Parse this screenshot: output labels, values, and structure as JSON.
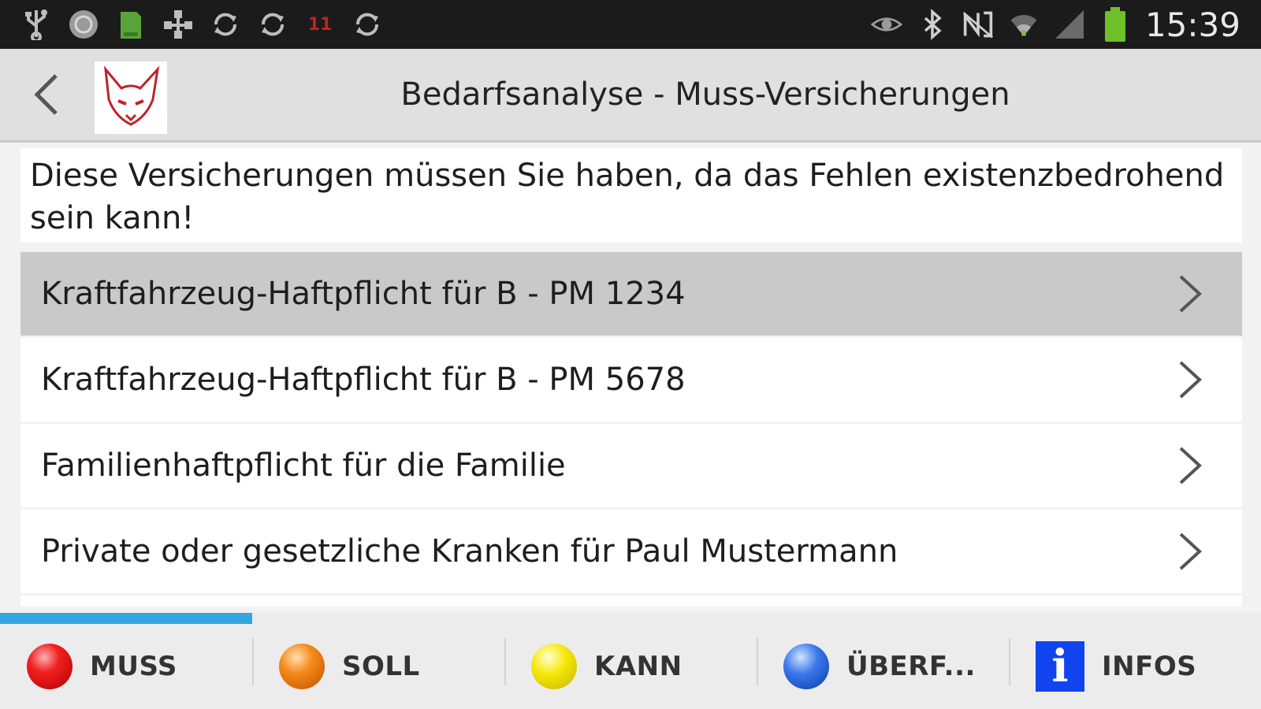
{
  "status_bar": {
    "time": "15:39",
    "left_icons": [
      "usb-icon",
      "sync-circle-icon",
      "sd-card-icon",
      "network-icon",
      "sync-icon",
      "sync-icon",
      "calendar-icon",
      "sync-icon"
    ],
    "right_icons": [
      "eye-icon",
      "bluetooth-icon",
      "nfc-icon",
      "wifi-icon",
      "signal-icon",
      "battery-icon"
    ],
    "calendar_day": "11"
  },
  "action_bar": {
    "title": "Bedarfsanalyse - Muss-Versicherungen",
    "back_icon": "chevron-left-icon",
    "logo_icon": "fox-logo-icon"
  },
  "intro_text": "Diese Versicherungen müssen Sie haben, da das Fehlen existenzbedrohend sein kann!",
  "list": [
    {
      "label": "Kraftfahrzeug-Haftpflicht für B - PM 1234",
      "selected": true
    },
    {
      "label": "Kraftfahrzeug-Haftpflicht für B - PM 5678",
      "selected": false
    },
    {
      "label": "Familienhaftpflicht für die Familie",
      "selected": false
    },
    {
      "label": "Private oder gesetzliche Kranken für Paul Mustermann",
      "selected": false
    }
  ],
  "tabs": [
    {
      "label": "MUSS",
      "icon": "red-ball-icon",
      "color": "#e01010",
      "active": true
    },
    {
      "label": "SOLL",
      "icon": "orange-ball-icon",
      "color": "#f07a10",
      "active": false
    },
    {
      "label": "KANN",
      "icon": "yellow-ball-icon",
      "color": "#f2e000",
      "active": false
    },
    {
      "label": "ÜBERF...",
      "icon": "blue-ball-icon",
      "color": "#2a6ae0",
      "active": false
    },
    {
      "label": "INFOS",
      "icon": "info-icon",
      "color": "#1144ee",
      "active": false
    }
  ],
  "colors": {
    "accent": "#33a6df",
    "status_bar_bg": "#1b1b1b",
    "action_bar_bg": "#e0e0e0",
    "selected_row_bg": "#c9c9c9"
  }
}
